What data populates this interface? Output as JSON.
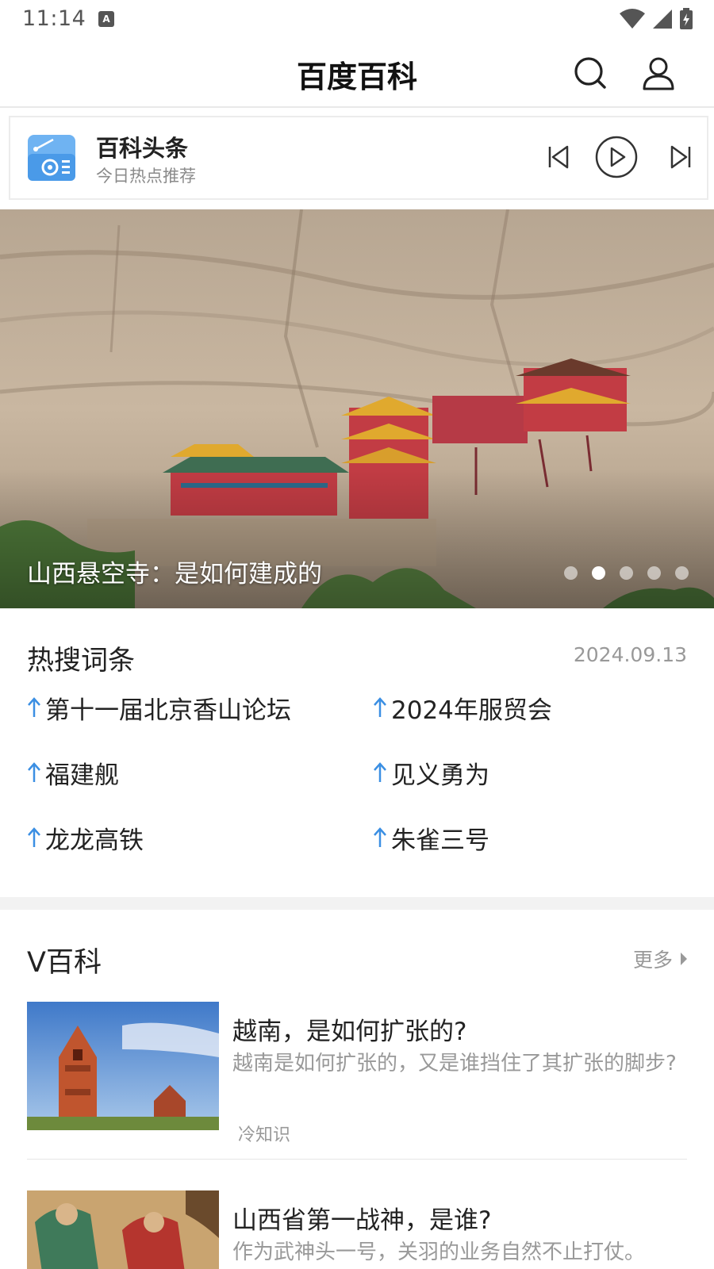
{
  "status_bar": {
    "time": "11:14",
    "notification_glyph": "A"
  },
  "header": {
    "title": "百度百科"
  },
  "headline_card": {
    "title": "百科头条",
    "subtitle": "今日热点推荐"
  },
  "banner": {
    "caption": "山西悬空寺：是如何建成的",
    "dot_count": 5,
    "active_dot": 1
  },
  "hot_search": {
    "title": "热搜词条",
    "date": "2024.09.13",
    "items": [
      {
        "label": "第十一届北京香山论坛"
      },
      {
        "label": "2024年服贸会"
      },
      {
        "label": "福建舰"
      },
      {
        "label": "见义勇为"
      },
      {
        "label": "龙龙高铁"
      },
      {
        "label": "朱雀三号"
      }
    ]
  },
  "v_baike": {
    "title": "V百科",
    "more": "更多",
    "articles": [
      {
        "title": "越南，是如何扩张的?",
        "desc": "越南是如何扩张的，又是谁挡住了其扩张的脚步?",
        "tag": "冷知识"
      },
      {
        "title": "山西省第一战神，是谁?",
        "desc": "作为武神头一号，关羽的业务自然不止打仗。"
      }
    ]
  },
  "colors": {
    "accent_blue": "#3b8fe3",
    "text_dark": "#222222",
    "text_muted": "#999999",
    "divider": "#e9e9e9"
  },
  "icons": [
    "search-icon",
    "user-icon",
    "radio-icon",
    "previous-icon",
    "play-icon",
    "next-icon",
    "arrow-up-icon",
    "chevron-right-icon"
  ]
}
